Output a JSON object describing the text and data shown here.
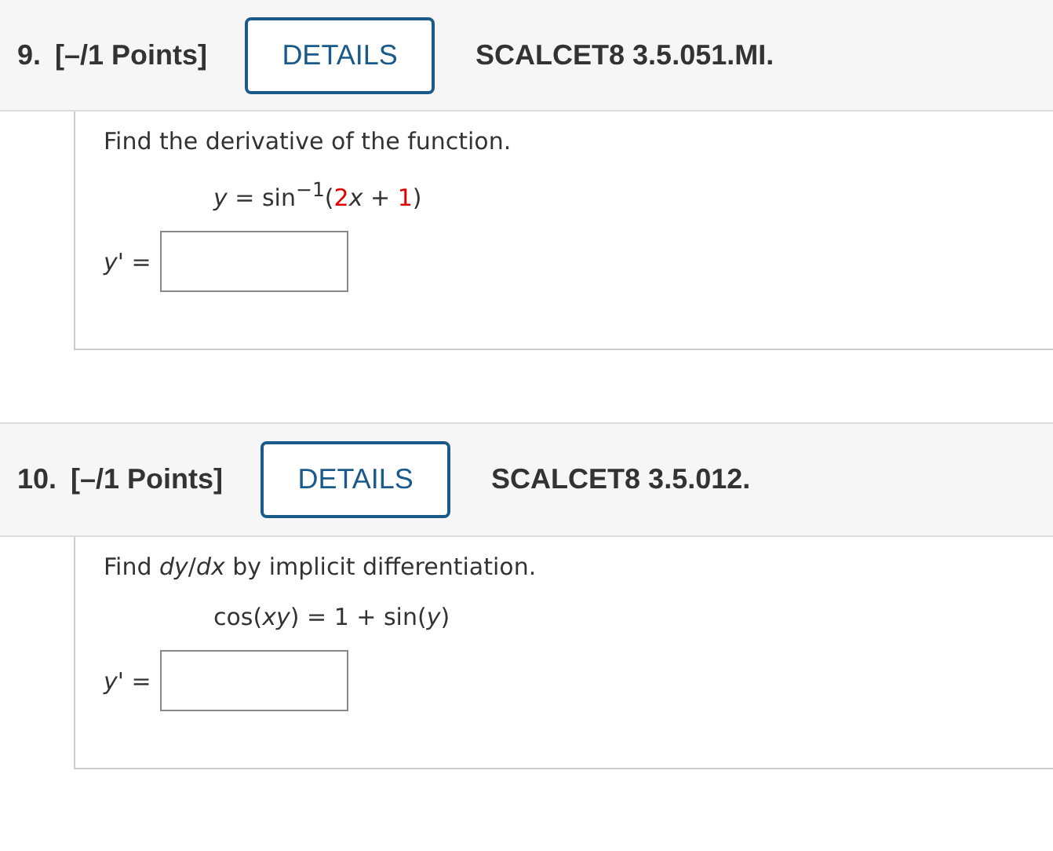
{
  "questions": [
    {
      "number": "9.",
      "points": "[–/1 Points]",
      "button": "DETAILS",
      "code": "SCALCET8 3.5.051.MI.",
      "prompt": "Find the derivative of the function.",
      "equation": [
        {
          "kind": "math",
          "text": "*y* = sin$^{−1}$("
        },
        {
          "kind": "given",
          "text": "2"
        },
        {
          "kind": "math",
          "text": "*x* + "
        },
        {
          "kind": "given",
          "text": "1"
        },
        {
          "kind": "math",
          "text": ")"
        }
      ],
      "answer_label": "*y*' ="
    },
    {
      "number": "10.",
      "points": "[–/1 Points]",
      "button": "DETAILS",
      "code": "SCALCET8 3.5.012.",
      "prompt": "Find *dy*/*dx* by implicit differentiation.",
      "equation": [
        {
          "kind": "math",
          "text": "cos(*xy*) = 1 + sin(*y*)"
        }
      ],
      "answer_label": "*y*' ="
    }
  ]
}
